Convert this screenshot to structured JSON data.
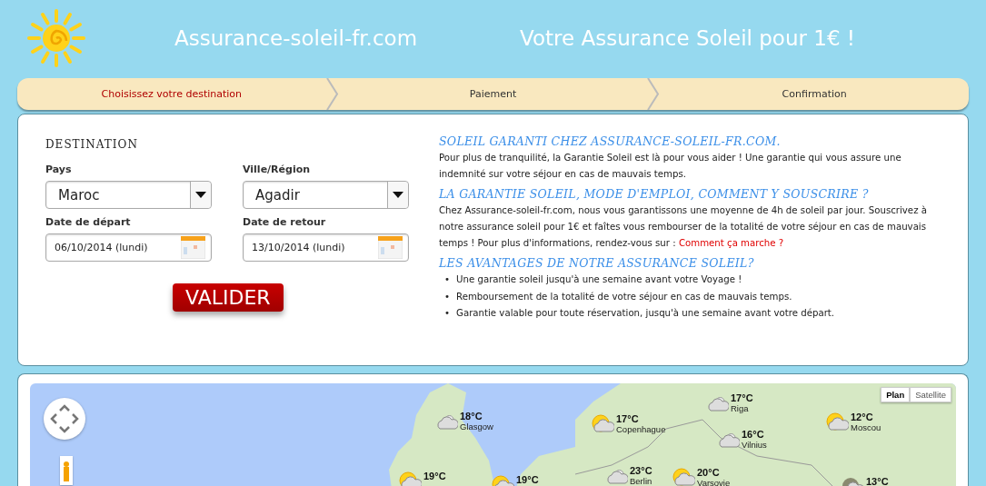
{
  "header": {
    "site_name": "Assurance-soleil-fr.com",
    "tagline": "Votre Assurance Soleil pour 1€ !"
  },
  "steps": [
    {
      "label": "Choisissez votre destination",
      "selected": true
    },
    {
      "label": "Paiement",
      "selected": false
    },
    {
      "label": "Confirmation",
      "selected": false
    }
  ],
  "form": {
    "title": "DESTINATION",
    "fields": [
      {
        "kind": "select",
        "label": "Pays",
        "value": "Maroc"
      },
      {
        "kind": "select",
        "label": "Ville/Région",
        "value": "Agadir"
      },
      {
        "kind": "date",
        "label": "Date de départ",
        "value": "06/10/2014 (lundi)"
      },
      {
        "kind": "date",
        "label": "Date de retour",
        "value": "13/10/2014 (lundi)"
      }
    ],
    "submit": "VALIDER"
  },
  "info": [
    {
      "heading": "SOLEIL GARANTI CHEZ ASSURANCE-SOLEIL-FR.COM.",
      "text": "Pour plus de tranquilité, la Garantie Soleil est là pour vous aider !  Une garantie qui vous assure une indemnité sur votre séjour en cas de mauvais temps."
    },
    {
      "heading": "LA GARANTIE SOLEIL, MODE D'EMPLOI, COMMENT Y SOUSCRIRE ?",
      "text": "Chez Assurance-soleil-fr.com, nous vous garantissons une moyenne de 4h de soleil par jour. Souscrivez à notre assurance soleil pour 1€ et faîtes vous rembourser de la totalité de votre séjour en cas de mauvais temps ! Pour plus d'informations, rendez-vous sur :",
      "link": "Comment ça marche ?"
    },
    {
      "heading": "LES AVANTAGES DE NOTRE ASSURANCE SOLEIL?",
      "bullet": "•",
      "bullets": [
        "Une garantie soleil jusqu'à une semaine avant votre Voyage !",
        "Remboursement de la totalité de votre séjour en cas de mauvais temps.",
        "Garantie valable pour toute réservation, jusqu'à une semaine avant votre départ."
      ]
    }
  ],
  "map": {
    "map_types": [
      {
        "label": "Plan",
        "selected": true
      },
      {
        "label": "Satellite",
        "selected": false
      }
    ],
    "weather": [
      {
        "kind": "cloud",
        "temp": "18°C",
        "city": "Glasgow"
      },
      {
        "kind": "sun",
        "temp": "17°C",
        "city": "Copenhague"
      },
      {
        "kind": "cloud",
        "temp": "17°C",
        "city": "Riga"
      },
      {
        "kind": "cloud",
        "temp": "16°C",
        "city": "Vilnius"
      },
      {
        "kind": "sun",
        "temp": "12°C",
        "city": "Moscou"
      },
      {
        "kind": "sun",
        "temp": "19°C"
      },
      {
        "kind": "sun",
        "temp": "19°C"
      },
      {
        "kind": "cloud",
        "temp": "23°C",
        "city": "Berlin"
      },
      {
        "kind": "sun",
        "temp": "20°C",
        "city": "Varsovie"
      },
      {
        "kind": "night",
        "temp": "13°C"
      }
    ]
  }
}
